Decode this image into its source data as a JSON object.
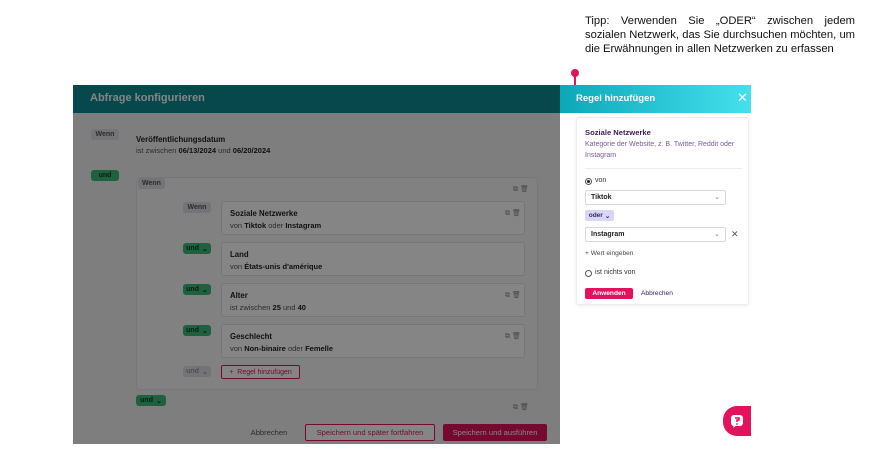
{
  "tip": "Tipp: Verwenden Sie „ODER“ zwischen jedem sozialen Netzwerk, das Sie durchsuchen möchten, um die Erwähnungen in allen Netzwerken zu erfassen",
  "main": {
    "title": "Abfrage konfigurieren",
    "wenn": "Wenn",
    "und": "und",
    "first_condition": {
      "title": "Veröffentlichungsdatum",
      "prefix": "ist zwischen",
      "date_from": "06/13/2024",
      "connector": "und",
      "date_to": "06/20/2024"
    },
    "group": {
      "wenn": "Wenn",
      "conditions": [
        {
          "operator": "Wenn",
          "title": "Soziale Netzwerke",
          "prefix": "von",
          "value_a": "Tiktok",
          "connector": "oder",
          "value_b": "Instagram"
        },
        {
          "operator": "und",
          "title": "Land",
          "prefix": "von",
          "value_a": "États-unis d'amérique"
        },
        {
          "operator": "und",
          "title": "Alter",
          "prefix": "ist zwischen",
          "value_a": "25",
          "connector": "und",
          "value_b": "40"
        },
        {
          "operator": "und",
          "title": "Geschlecht",
          "prefix": "von",
          "value_a": "Non-binaire",
          "connector": "oder",
          "value_b": "Femelle"
        }
      ],
      "disabled_operator": "und",
      "add_rule": "Regel hinzufügen"
    },
    "bottom_und": "und",
    "footer": {
      "cancel": "Abbrechen",
      "save_later": "Speichern und später fortfahren",
      "save_run": "Speichern und ausführen"
    }
  },
  "panel": {
    "title": "Regel hinzufügen",
    "close_glyph": "✕",
    "rule_title": "Soziale Netzwerke",
    "description": "Kategorie der Website, z. B. Twitter, Reddit oder Instagram",
    "radio_von": "von",
    "select1": "Tiktok",
    "oder": "oder",
    "select2": "Instagram",
    "add_value": "Wert eingeben",
    "radio_empty": "ist nichts von",
    "apply": "Anwenden",
    "cancel": "Abbrechen"
  },
  "colors": {
    "accent": "#e2125d",
    "header_teal": "#0c8b92",
    "panel_header": "#0ca8b8",
    "green_pill": "#3db87a"
  }
}
